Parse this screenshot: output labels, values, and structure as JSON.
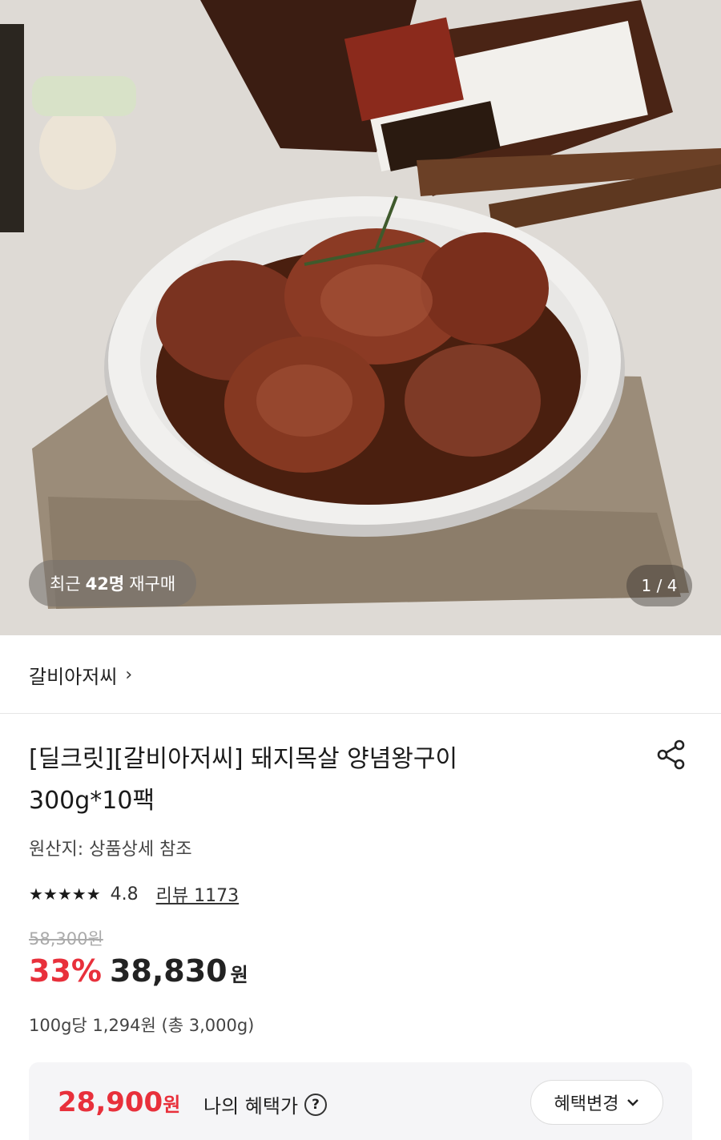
{
  "hero": {
    "repurchase_prefix": "최근",
    "repurchase_count": "42명",
    "repurchase_suffix": "재구매",
    "image_counter": "1 / 4"
  },
  "brand": {
    "name": "갈비아저씨",
    "chevron": "›"
  },
  "product": {
    "title_line1": "[딜크릿][갈비아저씨] 돼지목살 양념왕구이",
    "title_line2": "300g*10팩",
    "origin": "원산지: 상품상세 참조",
    "rating_stars": "★★★★★",
    "rating_value": "4.8",
    "review_label": "리뷰 1173"
  },
  "pricing": {
    "original_price": "58,300원",
    "discount": "33%",
    "sale_price": "38,830",
    "currency": "원",
    "unit_price": "100g당 1,294원 (총 3,000g)"
  },
  "benefit": {
    "price": "28,900",
    "currency": "원",
    "label": "나의 혜택가",
    "help": "?",
    "change_button": "혜택변경",
    "change_chevron": "⌄"
  },
  "colors": {
    "accent_red": "#e8303b"
  },
  "icons": [
    "share-icon",
    "help-icon",
    "chevron-right-icon",
    "chevron-down-icon",
    "star-icon"
  ]
}
